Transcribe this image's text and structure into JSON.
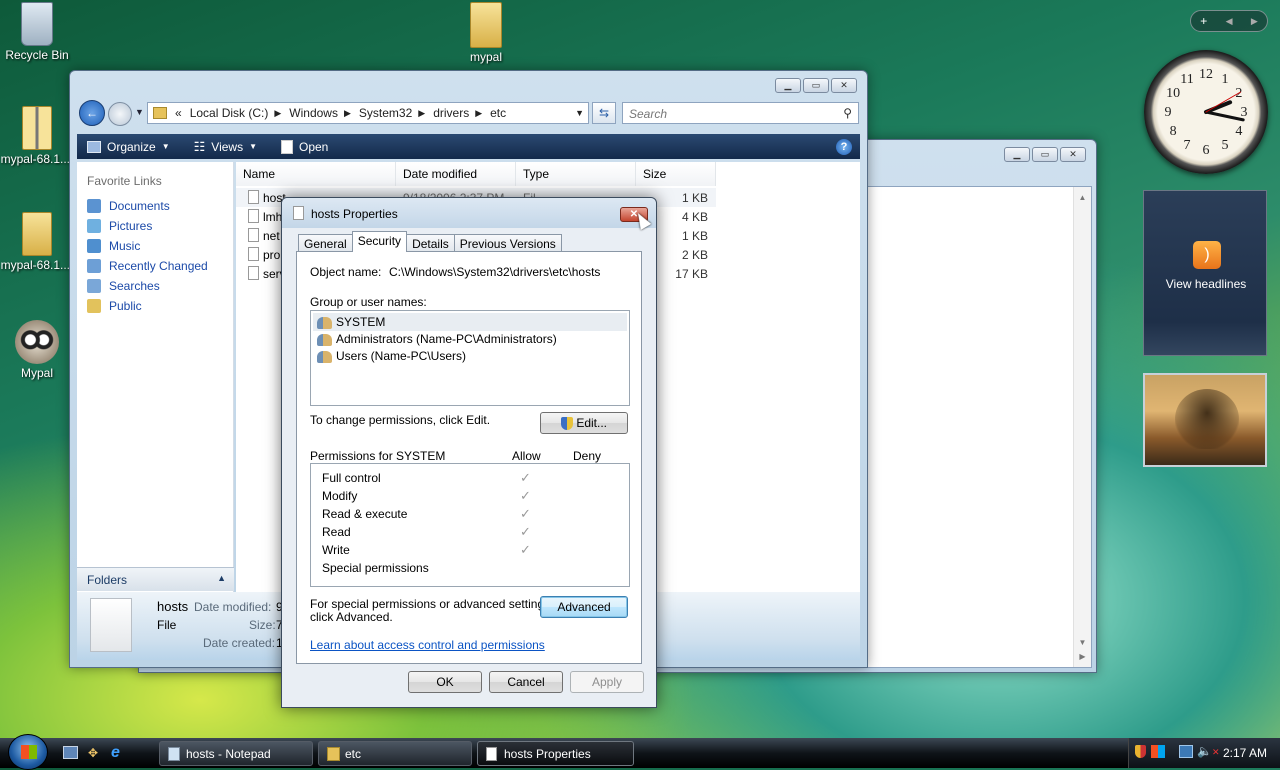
{
  "desktop": {
    "icons": [
      {
        "label": "Recycle Bin",
        "icon": "recycle-bin-icon"
      },
      {
        "label": "mypal",
        "icon": "folder-icon"
      },
      {
        "label": "mypal-68.1....",
        "icon": "zip-folder-icon"
      },
      {
        "label": "mypal-68.1....",
        "icon": "folder-icon"
      },
      {
        "label": "Mypal",
        "icon": "mypal-raccoon-icon"
      }
    ]
  },
  "explorer": {
    "breadcrumb": [
      "Local Disk (C:)",
      "Windows",
      "System32",
      "drivers",
      "etc"
    ],
    "search_placeholder": "Search",
    "toolbar": {
      "organize": "Organize",
      "views": "Views",
      "open": "Open"
    },
    "favorites_header": "Favorite Links",
    "favorites": [
      "Documents",
      "Pictures",
      "Music",
      "Recently Changed",
      "Searches",
      "Public"
    ],
    "folders_label": "Folders",
    "columns": [
      "Name",
      "Date modified",
      "Type",
      "Size"
    ],
    "files": [
      {
        "name": "host",
        "date": "9/18/2006 2:37 PM",
        "type": "Fil",
        "size": "1 KB"
      },
      {
        "name": "lmh",
        "size": "4 KB"
      },
      {
        "name": "net",
        "size": "1 KB"
      },
      {
        "name": "pro",
        "size": "2 KB"
      },
      {
        "name": "serv",
        "size": "17 KB"
      }
    ],
    "details": {
      "name": "hosts",
      "type": "File",
      "date_modified_label": "Date modified:",
      "date_modified_value": "9",
      "size_label": "Size:",
      "size_value": "7",
      "date_created_label": "Date created:",
      "date_created_value": "1"
    }
  },
  "dialog": {
    "title": "hosts Properties",
    "tabs": [
      "General",
      "Security",
      "Details",
      "Previous Versions"
    ],
    "selected_tab": "Security",
    "object_name_label": "Object name:",
    "object_name_value": "C:\\Windows\\System32\\drivers\\etc\\hosts",
    "group_label": "Group or user names:",
    "users": [
      "SYSTEM",
      "Administrators (Name-PC\\Administrators)",
      "Users (Name-PC\\Users)"
    ],
    "change_hint": "To change permissions, click Edit.",
    "edit_button": "Edit...",
    "perms_label": "Permissions for SYSTEM",
    "allow_label": "Allow",
    "deny_label": "Deny",
    "permissions": [
      {
        "name": "Full control",
        "allow": true
      },
      {
        "name": "Modify",
        "allow": true
      },
      {
        "name": "Read & execute",
        "allow": true
      },
      {
        "name": "Read",
        "allow": true
      },
      {
        "name": "Write",
        "allow": true
      },
      {
        "name": "Special permissions",
        "allow": false
      }
    ],
    "special_hint_1": "For special permissions or advanced settings,",
    "special_hint_2": "click Advanced.",
    "advanced_button": "Advanced",
    "learn_link": "Learn about access control and permissions",
    "ok_button": "OK",
    "cancel_button": "Cancel",
    "apply_button": "Apply"
  },
  "gadgets": {
    "feed_label": "View headlines",
    "clock_numbers": [
      "12",
      "1",
      "2",
      "3",
      "4",
      "5",
      "6",
      "7",
      "8",
      "9",
      "10",
      "11"
    ]
  },
  "taskbar": {
    "buttons": [
      "hosts - Notepad",
      "etc",
      "hosts Properties"
    ],
    "active": "hosts Properties",
    "time": "2:17 AM"
  },
  "colors": {
    "accent": "#1c4aa8",
    "toolbar": "#1d365a",
    "close_button": "#c4452f"
  }
}
